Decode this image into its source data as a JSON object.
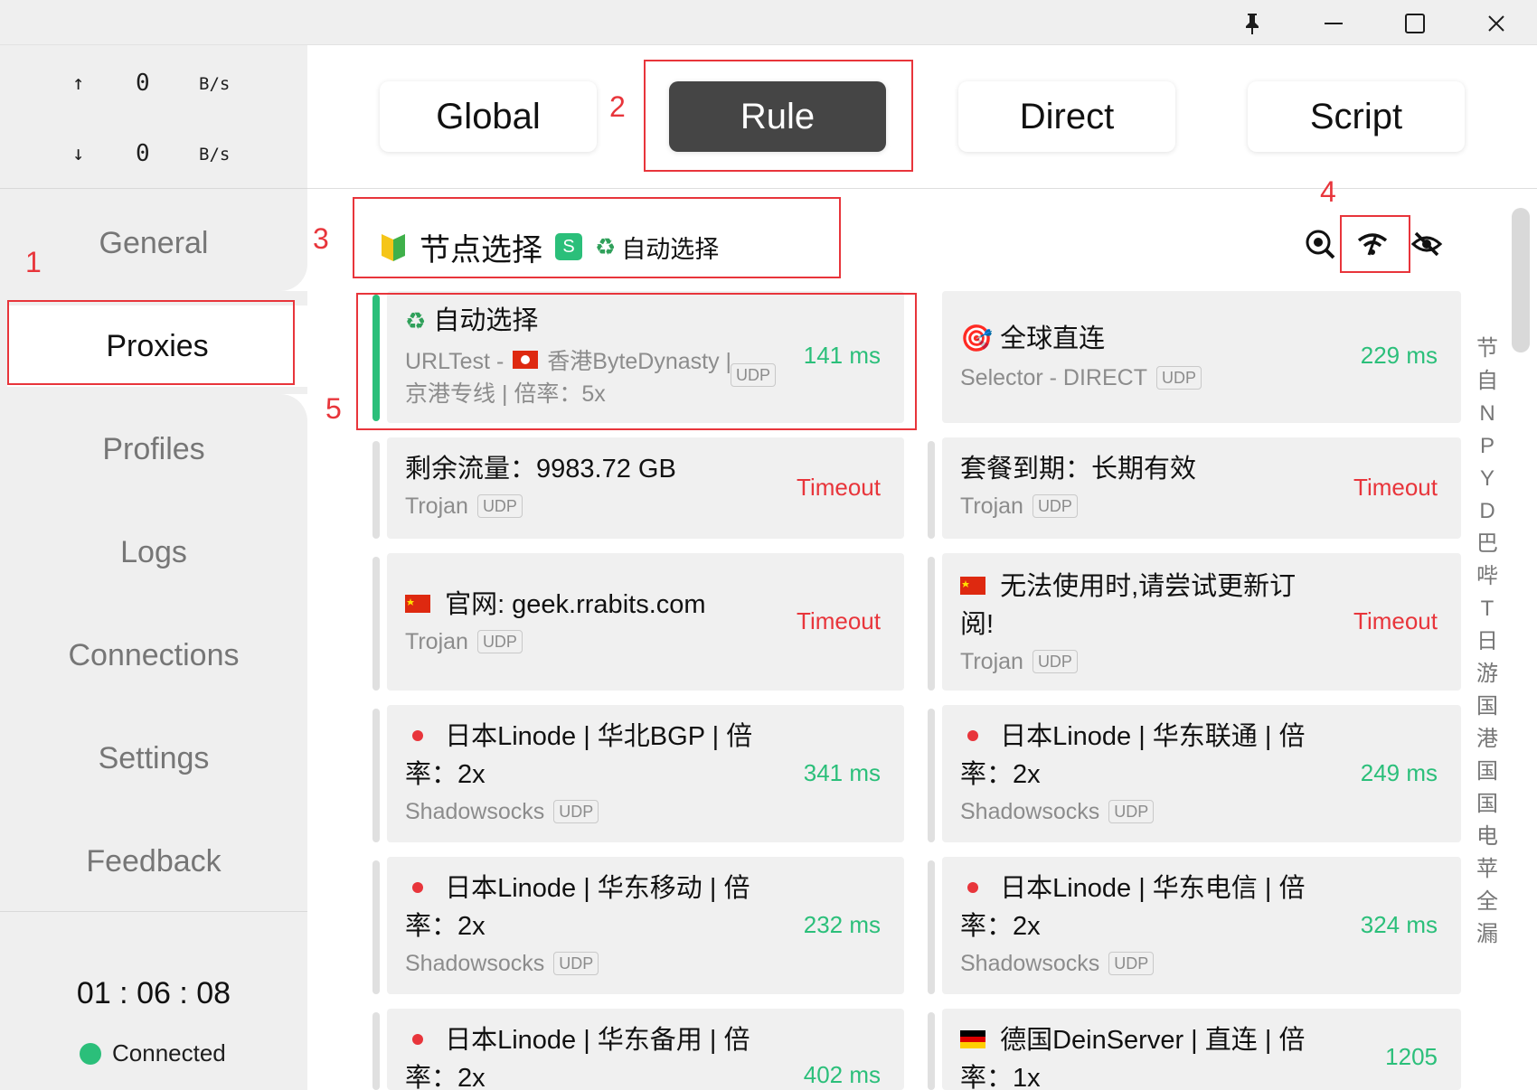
{
  "window": {
    "pin_icon": "pin-icon",
    "minimize_icon": "minimize-icon",
    "maximize_icon": "maximize-icon",
    "close_icon": "close-icon"
  },
  "traffic": {
    "up_arrow": "↑",
    "up_value": "0",
    "up_unit": "B/s",
    "down_arrow": "↓",
    "down_value": "0",
    "down_unit": "B/s"
  },
  "nav": [
    {
      "label": "General"
    },
    {
      "label": "Proxies"
    },
    {
      "label": "Profiles"
    },
    {
      "label": "Logs"
    },
    {
      "label": "Connections"
    },
    {
      "label": "Settings"
    },
    {
      "label": "Feedback"
    }
  ],
  "timer": "01 : 06 : 08",
  "status": {
    "label": "Connected",
    "color": "#2bbf7a"
  },
  "modes": [
    {
      "label": "Global"
    },
    {
      "label": "Rule"
    },
    {
      "label": "Direct"
    },
    {
      "label": "Script"
    }
  ],
  "callouts": [
    "1",
    "2",
    "3",
    "4",
    "5"
  ],
  "group": {
    "title": "节点选择",
    "badge": "S",
    "current_icon": "♻",
    "current": "自动选择"
  },
  "tools": [
    "locate-search-icon",
    "speed-test-wifi-icon",
    "hide-eye-icon"
  ],
  "index_letters": [
    "节",
    "自",
    "N",
    "P",
    "Y",
    "D",
    "巴",
    "哔",
    "T",
    "日",
    "游",
    "国",
    "港",
    "国",
    "国",
    "电",
    "苹",
    "全",
    "漏"
  ],
  "cards": [
    {
      "name": "自动选择",
      "icon": "♻",
      "meta": "URLTest - ",
      "meta_flag": "hk",
      "meta2": "香港ByteDynasty |",
      "meta3": "京港专线 | 倍率：5x",
      "udp": "UDP",
      "delay": "141 ms"
    },
    {
      "name": "全球直连",
      "icon": "🎯",
      "meta": "Selector - DIRECT",
      "udp": "UDP",
      "delay": "229 ms"
    },
    {
      "name": "剩余流量：9983.72 GB",
      "meta": "Trojan",
      "udp": "UDP",
      "delay": "Timeout"
    },
    {
      "name": "套餐到期：长期有效",
      "meta": "Trojan",
      "udp": "UDP",
      "delay": "Timeout"
    },
    {
      "name": "官网: geek.rrabits.com",
      "flag": "cn",
      "meta": "Trojan",
      "udp": "UDP",
      "delay": "Timeout"
    },
    {
      "name_line1": "无法使用时,请尝试更新订",
      "name_line2": "阅!",
      "flag": "cn",
      "meta": "Trojan",
      "udp": "UDP",
      "delay": "Timeout"
    },
    {
      "name_line1": "日本Linode | 华北BGP | 倍",
      "name_line2": "率：2x",
      "flag": "jp",
      "meta": "Shadowsocks",
      "udp": "UDP",
      "delay": "341 ms"
    },
    {
      "name_line1": "日本Linode | 华东联通 | 倍",
      "name_line2": "率：2x",
      "flag": "jp",
      "meta": "Shadowsocks",
      "udp": "UDP",
      "delay": "249 ms"
    },
    {
      "name_line1": "日本Linode | 华东移动 | 倍",
      "name_line2": "率：2x",
      "flag": "jp",
      "meta": "Shadowsocks",
      "udp": "UDP",
      "delay": "232 ms"
    },
    {
      "name_line1": "日本Linode | 华东电信 | 倍",
      "name_line2": "率：2x",
      "flag": "jp",
      "meta": "Shadowsocks",
      "udp": "UDP",
      "delay": "324 ms"
    },
    {
      "name_line1": "日本Linode | 华东备用 | 倍",
      "name_line2": "率：2x",
      "flag": "jp",
      "delay": "402 ms"
    },
    {
      "name_line1": "德国DeinServer | 直连 | 倍",
      "name_line2": "率：1x",
      "flag": "de",
      "delay": "1205"
    }
  ],
  "colors": {
    "accent_green": "#2bbf7a",
    "timeout_red": "#e8353b",
    "annotation_red": "#e8353b",
    "active_mode_bg": "#454545"
  }
}
